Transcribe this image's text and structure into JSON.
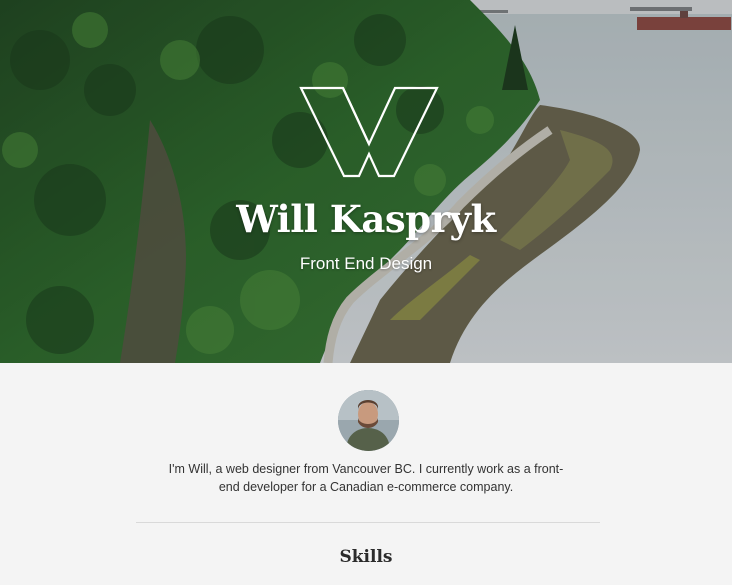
{
  "hero": {
    "name": "Will Kaspryk",
    "subtitle": "Front End Design",
    "logo_icon": "w-monogram-logo",
    "background_image": "forest-seawall-photo"
  },
  "about": {
    "avatar_icon": "profile-photo",
    "bio": "I'm Will, a web designer from Vancouver BC. I currently work as a front-end developer for a Canadian e-commerce company."
  },
  "skills": {
    "title": "Skills"
  },
  "colors": {
    "page_background": "#f4f4f4",
    "text": "#333333",
    "heading": "#2b2b2b",
    "hero_text": "#ffffff",
    "divider": "#d9d9d9"
  }
}
